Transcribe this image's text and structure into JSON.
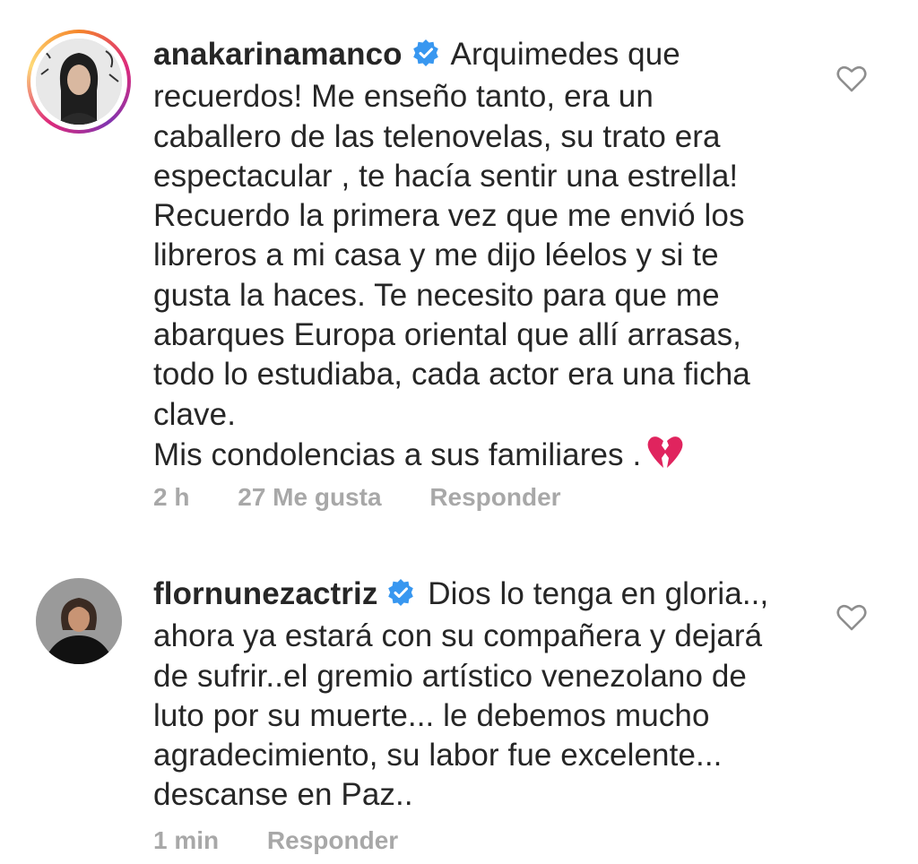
{
  "comments": [
    {
      "username": "anakarinamanco",
      "text_lines": [
        "Arquimedes que",
        "recuerdos! Me enseño tanto, era un",
        "caballero de las telenovelas, su trato era",
        "espectacular , te hacía sentir una estrella!",
        "Recuerdo la primera vez que me envió los",
        "libreros a mi casa y me dijo léelos y si te",
        "gusta la haces. Te necesito para que me",
        "abarques Europa oriental que allí arrasas,",
        "todo lo estudiaba, cada actor era una ficha",
        "clave.",
        "Mis condolencias a sus familiares ."
      ],
      "time": "2 h",
      "likes": "27 Me gusta",
      "reply_label": "Responder",
      "verified_icon": "verified-badge-icon",
      "end_emoji_icon": "broken-heart-icon"
    },
    {
      "username": "flornunezactriz",
      "text_lines": [
        "Dios lo tenga en gloria..,",
        "ahora ya estará con su compañera y dejará",
        "de sufrir..el gremio artístico venezolano de",
        "luto por su muerte... le debemos mucho",
        "agradecimiento, su labor fue excelente...",
        "descanse en Paz.."
      ],
      "time": "1 min",
      "reply_label": "Responder",
      "verified_icon": "verified-badge-icon"
    }
  ],
  "colors": {
    "text": "#262626",
    "meta": "#a8a8a8",
    "verified": "#3897f0",
    "broken_heart": "#e0245e"
  }
}
